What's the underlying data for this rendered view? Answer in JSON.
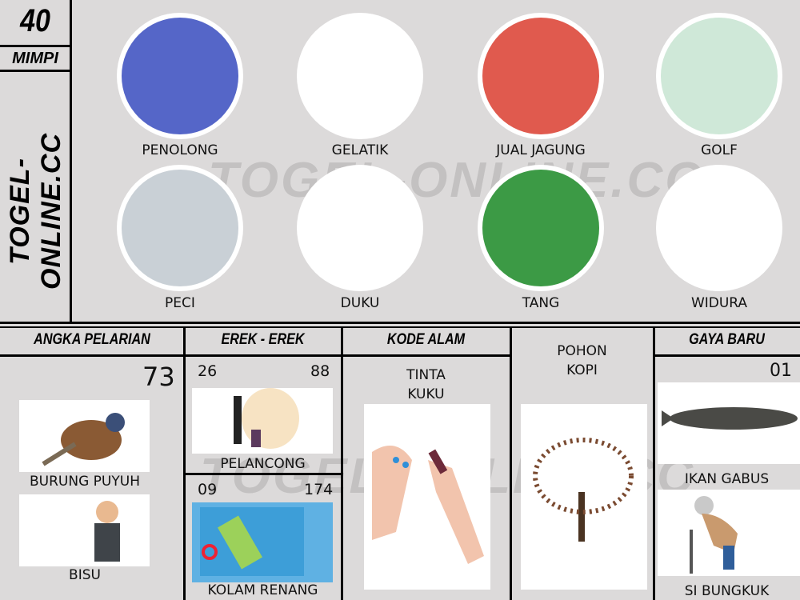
{
  "sidebar": {
    "number": "40",
    "label": "MIMPI",
    "site": "TOGEL-ONLINE.CC"
  },
  "watermark": "TOGEL-ONLINE.CC",
  "top_items": [
    {
      "label": "PENOLONG",
      "color": "#5566c8"
    },
    {
      "label": "GELATIK",
      "color": "#ffffff"
    },
    {
      "label": "JUAL JAGUNG",
      "color": "#e05a4e"
    },
    {
      "label": "GOLF",
      "color": "#cfe8d8"
    },
    {
      "label": "PECI",
      "color": "#c9d0d6"
    },
    {
      "label": "DUKU",
      "color": "#ffffff"
    },
    {
      "label": "TANG",
      "color": "#3c9a45"
    },
    {
      "label": "WIDURA",
      "color": "#ffffff"
    }
  ],
  "angka_pelarian": {
    "title": "ANGKA PELARIAN",
    "number": "73",
    "items": [
      "BURUNG PUYUH",
      "BISU"
    ]
  },
  "erek_erek": {
    "title": "EREK - EREK",
    "rows": [
      {
        "left": "26",
        "right": "88",
        "label": "PELANCONG"
      },
      {
        "left": "09",
        "right": "174",
        "label": "KOLAM RENANG"
      }
    ]
  },
  "kode_alam": {
    "title": "KODE ALAM",
    "line1": "TINTA",
    "line2": "KUKU"
  },
  "pohon": {
    "line1": "POHON",
    "line2": "KOPI"
  },
  "gaya_baru": {
    "title": "GAYA BARU",
    "number": "01",
    "items": [
      "IKAN GABUS",
      "SI BUNGKUK"
    ]
  }
}
